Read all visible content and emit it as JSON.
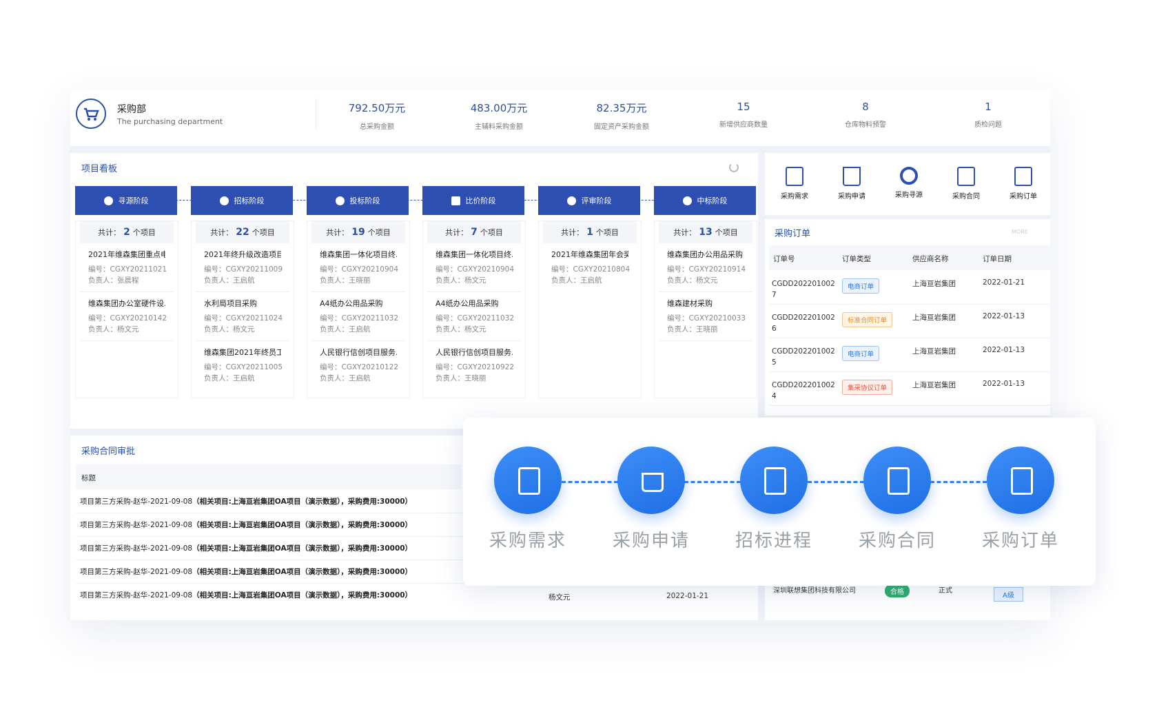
{
  "header": {
    "dept_title": "采购部",
    "dept_subtitle": "The purchasing department",
    "stats": [
      {
        "value": "792.50万元",
        "label": "总采购金额"
      },
      {
        "value": "483.00万元",
        "label": "主辅料采购金额"
      },
      {
        "value": "82.35万元",
        "label": "固定资产采购金额"
      },
      {
        "value": "15",
        "label": "新增供应商数量"
      },
      {
        "value": "8",
        "label": "仓库物料预警"
      },
      {
        "value": "1",
        "label": "质检问题"
      }
    ]
  },
  "board": {
    "title": "项目看板",
    "stages": [
      {
        "label": "寻源阶段",
        "icon": "compass-icon",
        "count_prefix": "共计：",
        "count": "2",
        "count_suffix": "个项目",
        "items": [
          {
            "title": "2021年维森集团重点电...",
            "code": "编号：CGXY20211021",
            "owner": "负责人：张晨程"
          },
          {
            "title": "维森集团办公室硬件设...",
            "code": "编号：CGXY20210142",
            "owner": "负责人：杨文元"
          }
        ]
      },
      {
        "label": "招标阶段",
        "icon": "send-icon",
        "count_prefix": "共计：",
        "count": "22",
        "count_suffix": "个项目",
        "items": [
          {
            "title": "2021年终升级改造项目...",
            "code": "编号：CGXY20211009",
            "owner": "负责人：王启航"
          },
          {
            "title": "水利局项目采购",
            "code": "编号：CGXY20211024",
            "owner": "负责人：杨文元"
          },
          {
            "title": "维森集团2021年终员工...",
            "code": "编号：CGXY20211005",
            "owner": "负责人：王启航"
          }
        ]
      },
      {
        "label": "投标阶段",
        "icon": "check-circle-icon",
        "count_prefix": "共计：",
        "count": "19",
        "count_suffix": "个项目",
        "items": [
          {
            "title": "维森集团一体化项目终...",
            "code": "编号：CGXY20210904",
            "owner": "负责人：王晓丽"
          },
          {
            "title": "A4纸办公用品采购",
            "code": "编号：CGXY20211032",
            "owner": "负责人：王启航"
          },
          {
            "title": "人民银行信创项目服务...",
            "code": "编号：CGXY20210122",
            "owner": "负责人：王启航"
          }
        ]
      },
      {
        "label": "比价阶段",
        "icon": "lock-icon",
        "count_prefix": "共计：",
        "count": "7",
        "count_suffix": "个项目",
        "items": [
          {
            "title": "维森集团一体化项目终...",
            "code": "编号：CGXY20210904",
            "owner": "负责人：杨文元"
          },
          {
            "title": "A4纸办公用品采购",
            "code": "编号：CGXY20211032",
            "owner": "负责人：杨文元"
          },
          {
            "title": "人民银行信创项目服务...",
            "code": "编号：CGXY20210922",
            "owner": "负责人：王晓丽"
          }
        ]
      },
      {
        "label": "评审阶段",
        "icon": "user-check-icon",
        "count_prefix": "共计：",
        "count": "1",
        "count_suffix": "个项目",
        "items": [
          {
            "title": "2021年维森集团年会奖...",
            "code": "编号：CGXY20210804",
            "owner": "负责人：王启航"
          }
        ]
      },
      {
        "label": "中标阶段",
        "icon": "check-badge-icon",
        "count_prefix": "共计：",
        "count": "13",
        "count_suffix": "个项目",
        "items": [
          {
            "title": "维森集团办公用品采购",
            "code": "编号：CGXY20210914",
            "owner": "负责人：杨文元"
          },
          {
            "title": "维森建材采购",
            "code": "编号：CGXY20210033",
            "owner": "负责人：王晓丽"
          }
        ]
      }
    ]
  },
  "quick": [
    {
      "label": "采购需求",
      "icon": "clipboard-list-icon"
    },
    {
      "label": "采购申请",
      "icon": "cart-icon"
    },
    {
      "label": "采购寻源",
      "icon": "target-icon"
    },
    {
      "label": "采购合同",
      "icon": "document-icon"
    },
    {
      "label": "采购订单",
      "icon": "order-search-icon"
    }
  ],
  "orders": {
    "title": "采购订单",
    "more": "MORE",
    "headers": [
      "订单号",
      "订单类型",
      "供应商名称",
      "订单日期"
    ],
    "rows": [
      {
        "no1": "CGDD202201002",
        "no2": "7",
        "type": "电商订单",
        "type_color": "blue",
        "supplier": "上海亘岩集团",
        "date": "2022-01-21"
      },
      {
        "no1": "CGDD202201002",
        "no2": "6",
        "type": "标准合同订单",
        "type_color": "orange",
        "supplier": "上海亘岩集团",
        "date": "2022-01-13"
      },
      {
        "no1": "CGDD202201002",
        "no2": "5",
        "type": "电商订单",
        "type_color": "blue",
        "supplier": "上海亘岩集团",
        "date": "2022-01-13"
      },
      {
        "no1": "CGDD202201002",
        "no2": "4",
        "type": "集采协议订单",
        "type_color": "red",
        "supplier": "上海亘岩集团",
        "date": "2022-01-13"
      }
    ]
  },
  "contract": {
    "title": "采购合同审批",
    "header": "标题",
    "row_prefix": "项目第三方采购-赵华-2021-09-08",
    "row_bold": "（相关项目:上海亘岩集团OA项目（演示数据），采购费用:30000）",
    "last_owner": "杨文元",
    "last_date": "2022-01-21"
  },
  "supplier_peek": {
    "name": "深圳联想集团科技有限公司",
    "status": "合格",
    "kind": "正式",
    "grade": "A级"
  },
  "flow": {
    "steps": [
      {
        "label": "采购需求",
        "icon": "clipboard-icon"
      },
      {
        "label": "采购申请",
        "icon": "basket-cursor-icon"
      },
      {
        "label": "招标进程",
        "icon": "cart-clipboard-icon"
      },
      {
        "label": "采购合同",
        "icon": "certificate-icon"
      },
      {
        "label": "采购订单",
        "icon": "order-check-icon"
      }
    ]
  }
}
